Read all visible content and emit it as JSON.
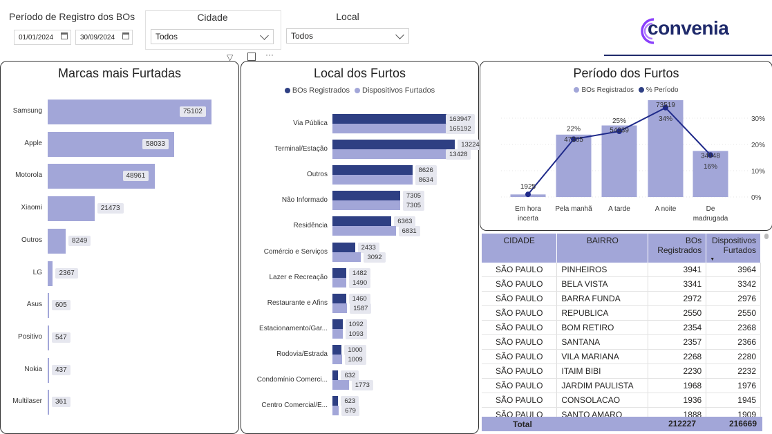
{
  "filters": {
    "period_label": "Período de Registro dos BOs",
    "date_start": "01/01/2024",
    "date_end": "30/09/2024",
    "cidade_label": "Cidade",
    "cidade_value": "Todos",
    "local_label": "Local",
    "local_value": "Todos"
  },
  "brand": {
    "logo_text": "convenia",
    "accent": "#8a3ffc",
    "navy": "#1f2a6b"
  },
  "colors": {
    "light": "#a2a6d8",
    "dark": "#2e3f83"
  },
  "chart_data": [
    {
      "type": "bar",
      "title": "Marcas mais Furtadas",
      "orientation": "horizontal",
      "categories": [
        "Samsung",
        "Apple",
        "Motorola",
        "Xiaomi",
        "Outros",
        "LG",
        "Asus",
        "Positivo",
        "Nokia",
        "Multilaser"
      ],
      "values": [
        75102,
        58033,
        48961,
        21473,
        8249,
        2367,
        605,
        547,
        437,
        361
      ]
    },
    {
      "type": "bar",
      "title": "Local dos Furtos",
      "orientation": "horizontal",
      "legend": [
        "BOs Registrados",
        "Dispositivos Furtados"
      ],
      "categories": [
        "Via Pública",
        "Terminal/Estação",
        "Outros",
        "Não Informado",
        "Residência",
        "Comércio e Serviços",
        "Lazer e Recreação",
        "Restaurante e Afins",
        "Estacionamento/Gar...",
        "Rodovia/Estrada",
        "Condomínio Comerci...",
        "Centro Comercial/E..."
      ],
      "series": [
        {
          "name": "BOs Registrados",
          "values": [
            163947,
            13224,
            8626,
            7305,
            6363,
            2433,
            1482,
            1460,
            1092,
            1000,
            632,
            623
          ]
        },
        {
          "name": "Dispositivos Furtados",
          "values": [
            165192,
            13428,
            8634,
            7305,
            6831,
            3092,
            1490,
            1587,
            1093,
            1009,
            1773,
            679
          ]
        }
      ]
    },
    {
      "type": "bar",
      "title": "Período dos Furtos",
      "legend": [
        "BOs Registrados",
        "% Período"
      ],
      "categories": [
        "Em hora incerta",
        "Pela manhã",
        "A tarde",
        "A noite",
        "De madrugada"
      ],
      "series": [
        {
          "name": "BOs Registrados",
          "values": [
            1925,
            47365,
            54339,
            73519,
            34948
          ]
        },
        {
          "name": "% Período",
          "values": [
            1,
            22,
            25,
            34,
            16
          ],
          "labels": [
            "",
            "22%",
            "25%",
            "34%",
            "16%"
          ]
        }
      ],
      "y2_ticks": [
        "30%",
        "20%",
        "10%",
        "0%"
      ]
    }
  ],
  "table": {
    "headers": [
      "CIDADE",
      "BAIRRO",
      "BOs Registrados",
      "Dispositivos Furtados"
    ],
    "rows": [
      [
        "SÃO PAULO",
        "PINHEIROS",
        "3941",
        "3964"
      ],
      [
        "SÃO PAULO",
        "BELA VISTA",
        "3341",
        "3342"
      ],
      [
        "SÃO PAULO",
        "BARRA FUNDA",
        "2972",
        "2976"
      ],
      [
        "SÃO PAULO",
        "REPUBLICA",
        "2550",
        "2550"
      ],
      [
        "SÃO PAULO",
        "BOM RETIRO",
        "2354",
        "2368"
      ],
      [
        "SÃO PAULO",
        "SANTANA",
        "2357",
        "2366"
      ],
      [
        "SÃO PAULO",
        "VILA MARIANA",
        "2268",
        "2280"
      ],
      [
        "SÃO PAULO",
        "ITAIM BIBI",
        "2230",
        "2232"
      ],
      [
        "SÃO PAULO",
        "JARDIM PAULISTA",
        "1968",
        "1976"
      ],
      [
        "SÃO PAULO",
        "CONSOLACAO",
        "1936",
        "1945"
      ],
      [
        "SÃO PAULO",
        "SANTO AMARO",
        "1888",
        "1909"
      ]
    ],
    "total_label": "Total",
    "total_bos": "212227",
    "total_disp": "216669"
  }
}
